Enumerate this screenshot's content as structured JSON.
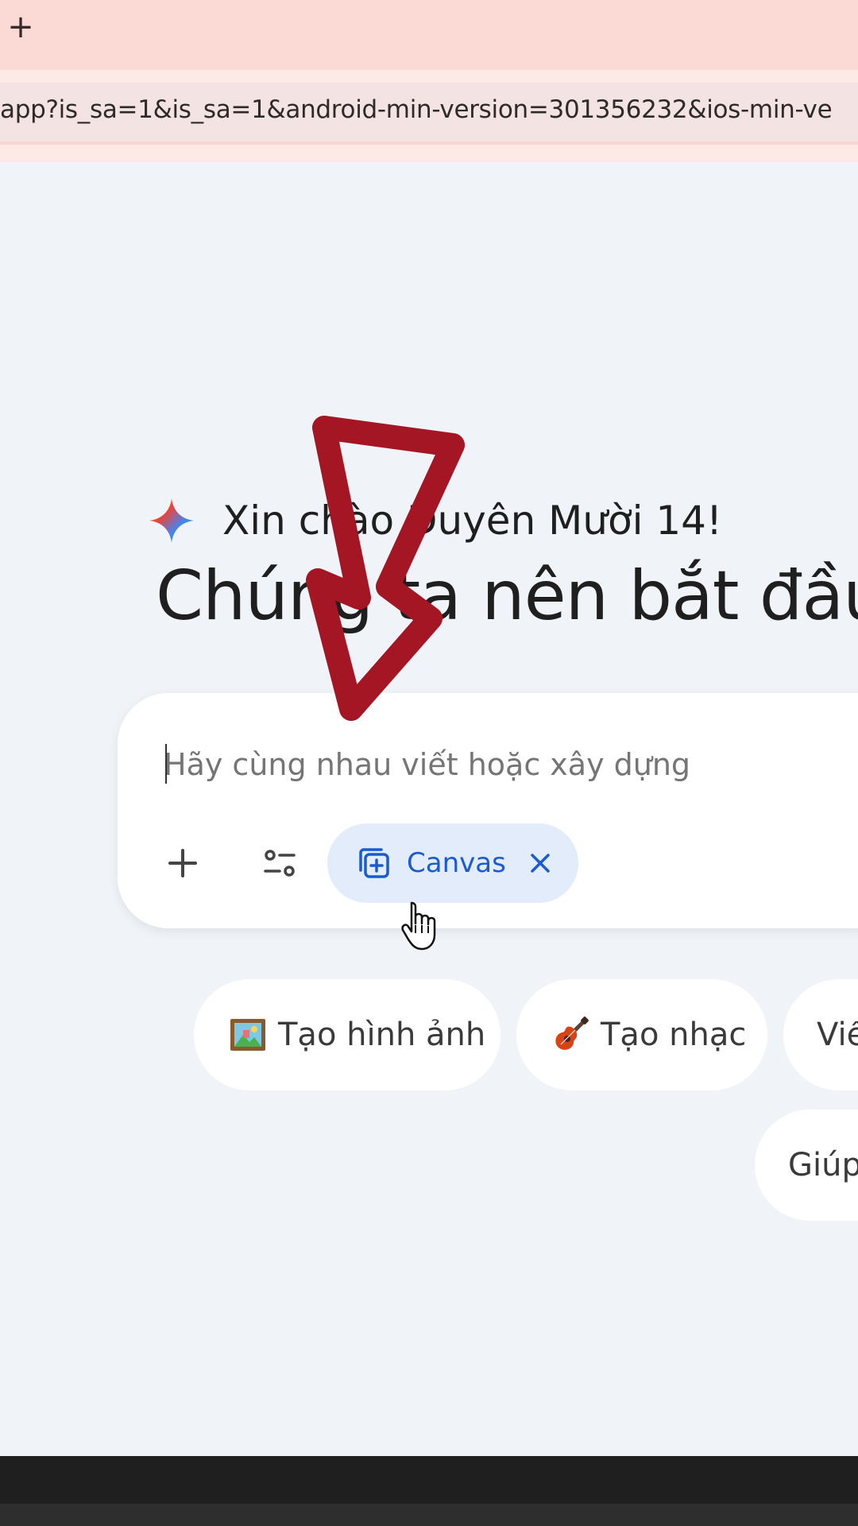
{
  "browser": {
    "new_tab_label": "+",
    "url": "app?is_sa=1&is_sa=1&android-min-version=301356232&ios-min-ve"
  },
  "greeting": {
    "text": "Xin chào Duyên Mười 14!",
    "headline": "Chúng ta nên bắt đầu"
  },
  "prompt": {
    "placeholder": "Hãy cùng nhau viết hoặc xây dựng",
    "canvas_chip_label": "Canvas"
  },
  "suggestions": [
    {
      "label": "Tạo hình ảnh",
      "icon": "framed-picture-icon"
    },
    {
      "label": "Tạo nhạc",
      "icon": "guitar-icon"
    },
    {
      "label": "Viế",
      "icon": ""
    },
    {
      "label": "Giúp",
      "icon": ""
    }
  ],
  "colors": {
    "tab_strip": "#fbd9d5",
    "page_bg": "#f0f4f8",
    "canvas_chip_bg": "#e3ecfb",
    "canvas_chip_text": "#1a5bd1",
    "annotation_arrow": "#a51624"
  }
}
